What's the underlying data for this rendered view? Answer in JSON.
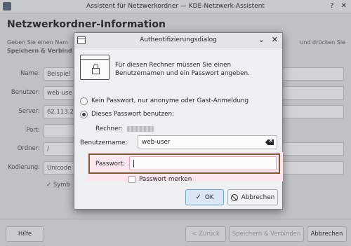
{
  "background_window": {
    "title": "Assistent für Netzwerkordner — KDE-Netzwerk-Assistent",
    "heading": "Netzwerkordner-Information",
    "description_start": "Geben Sie einen Nam",
    "description_end": "und drücken Sie",
    "description_line2": "Speichern & Verbind",
    "fields": [
      {
        "label": "Name:",
        "value": "Beispiel"
      },
      {
        "label": "Benutzer:",
        "value": "web-use"
      },
      {
        "label": "Server:",
        "value": "62.113.2"
      },
      {
        "label": "Port:",
        "value": ""
      },
      {
        "label": "Ordner:",
        "value": "/"
      },
      {
        "label": "Kodierung:",
        "value": "Unicode"
      }
    ],
    "checkbox_label": "Symb",
    "buttons": {
      "help": "Hilfe",
      "back": "< Zurück",
      "save_connect": "Speichern & Verbinden",
      "cancel": "Abbrechen"
    }
  },
  "dialog": {
    "title": "Authentifizierungsdialog",
    "message": "Für diesen Rechner müssen Sie einen Benutzernamen und ein Passwort angeben.",
    "option_anonymous": "Kein Passwort, nur anonyme oder Gast-Anmeldung",
    "option_password": "Dieses Passwort benutzen:",
    "rechner_label": "Rechner:",
    "username_label": "Benutzername:",
    "username_value": "web-user",
    "password_label": "Passwort:",
    "password_value": "",
    "remember_label": "Passwort merken",
    "ok_label": "OK",
    "cancel_label": "Abbrechen"
  }
}
